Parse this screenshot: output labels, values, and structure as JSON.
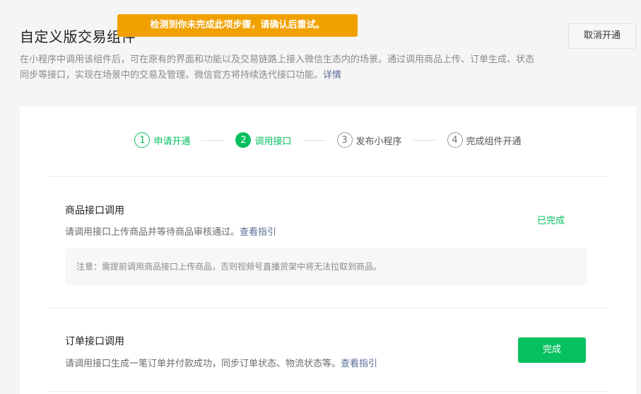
{
  "header": {
    "title": "自定义版交易组件",
    "description": "在小程序中调用该组件后，可在原有的界面和功能以及交易链路上接入微信生态内的场景。通过调用商品上传、订单生成、状态同步等接口，实现在场景中的交易及管理。微信官方将持续迭代接口功能。",
    "detail_link": "详情",
    "cancel_label": "取消开通"
  },
  "toast": {
    "message": "检测到你未完成此项步骤，请确认后重试。",
    "color": "#f0a100"
  },
  "steps": [
    {
      "num": "1",
      "label": "申请开通",
      "state": "done"
    },
    {
      "num": "2",
      "label": "调用接口",
      "state": "active"
    },
    {
      "num": "3",
      "label": "发布小程序",
      "state": "pending"
    },
    {
      "num": "4",
      "label": "完成组件开通",
      "state": "pending"
    }
  ],
  "product_section": {
    "title": "商品接口调用",
    "description": "请调用接口上传商品并等待商品审核通过。",
    "guide_link": "查看指引",
    "status": "已完成",
    "notice": "注意：需提前调用商品接口上传商品，否则视频号直播货架中将无法拉取到商品。"
  },
  "order_section": {
    "title": "订单接口调用",
    "description": "请调用接口生成一笔订单并付款成功，同步订单状态、物流状态等。",
    "guide_link": "查看指引",
    "finish_label": "完成"
  },
  "colors": {
    "accent": "#07c160",
    "link": "#576b95"
  }
}
